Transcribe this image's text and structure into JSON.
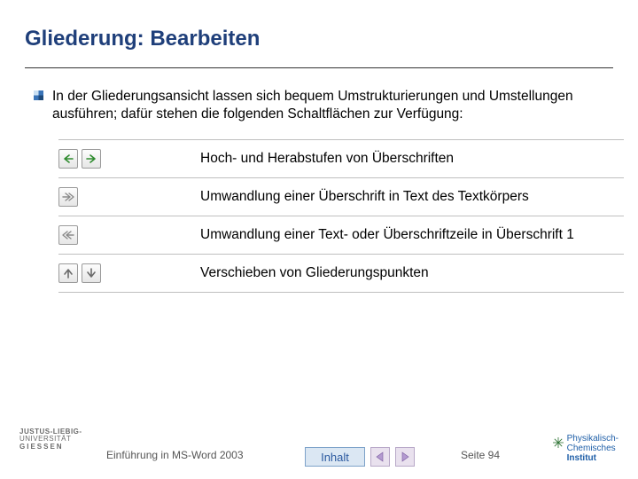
{
  "title": "Gliederung: Bearbeiten",
  "intro": "In der Gliederungsansicht lassen sich bequem Umstrukturierungen und Umstellungen ausführen; dafür stehen die folgenden Schaltflächen zur Verfügung:",
  "functions": {
    "row1": {
      "icon1": "arrow-left-green",
      "icon2": "arrow-right-green",
      "label": "Hoch- und Herabstufen von Überschriften"
    },
    "row2": {
      "icon1": "double-arrow-right",
      "label": "Umwandlung einer Überschrift in Text des Textkörpers"
    },
    "row3": {
      "icon1": "double-arrow-left",
      "label": "Umwandlung einer Text- oder Überschriftzeile in Überschrift 1"
    },
    "row4": {
      "icon1": "arrow-up",
      "icon2": "arrow-down",
      "label": "Verschieben von Gliederungspunkten"
    }
  },
  "footer": {
    "uni_line1": "JUSTUS-LIEBIG-",
    "uni_line2": "UNIVERSITÄT",
    "uni_line3": "GIESSEN",
    "doc_title": "Einführung in MS-Word 2003",
    "inhalt_label": "Inhalt",
    "page_label": "Seite 94",
    "chem_line1": "Physikalisch-",
    "chem_line2": "Chemisches",
    "chem_line3": "Institut"
  }
}
